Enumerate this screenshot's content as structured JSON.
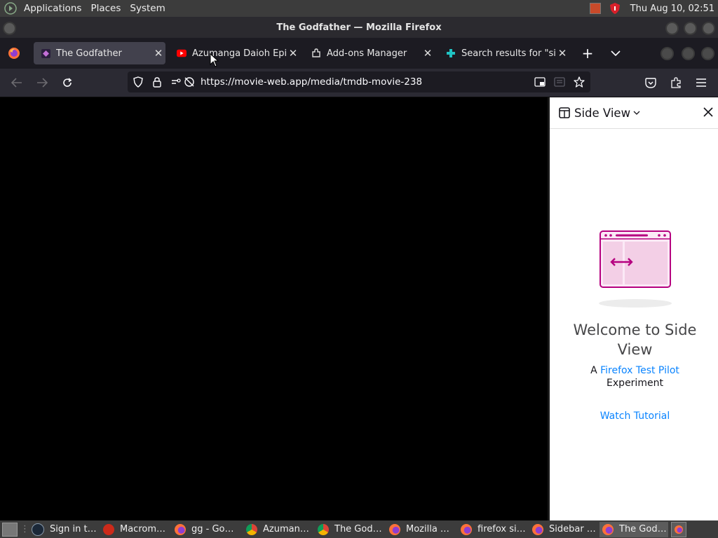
{
  "panel": {
    "menus": [
      "Applications",
      "Places",
      "System"
    ],
    "clock": "Thu Aug 10, 02:51"
  },
  "window": {
    "title": "The Godfather — Mozilla Firefox"
  },
  "tabs": [
    {
      "label": "The Godfather",
      "active": true
    },
    {
      "label": "Azumanga Daioh Episode",
      "active": false
    },
    {
      "label": "Add-ons Manager",
      "active": false
    },
    {
      "label": "Search results for \"side",
      "active": false
    }
  ],
  "nav": {
    "url": "https://movie-web.app/media/tmdb-movie-238"
  },
  "sidebar": {
    "title": "Side View",
    "welcome": "Welcome to Side View",
    "experiment_prefix": "A",
    "experiment_link": "Firefox Test Pilot",
    "experiment_suffix": "Experiment",
    "tutorial_link": "Watch Tutorial"
  },
  "taskbar": [
    {
      "label": "Sign in t…",
      "icon": "steam-icon"
    },
    {
      "label": "Macrom…",
      "icon": "flash-icon"
    },
    {
      "label": "gg - Go…",
      "icon": "firefox-icon"
    },
    {
      "label": "Azuman…",
      "icon": "chrome-icon"
    },
    {
      "label": "The God…",
      "icon": "chrome-icon"
    },
    {
      "label": "Mozilla …",
      "icon": "firefox-icon"
    },
    {
      "label": "firefox si…",
      "icon": "firefox-icon"
    },
    {
      "label": "Sidebar …",
      "icon": "firefox-icon"
    },
    {
      "label": "The God…",
      "icon": "firefox-icon"
    }
  ],
  "colors": {
    "accent_link": "#0a84ff",
    "sideview_magenta": "#b5007f",
    "tab_active": "#42414d"
  }
}
